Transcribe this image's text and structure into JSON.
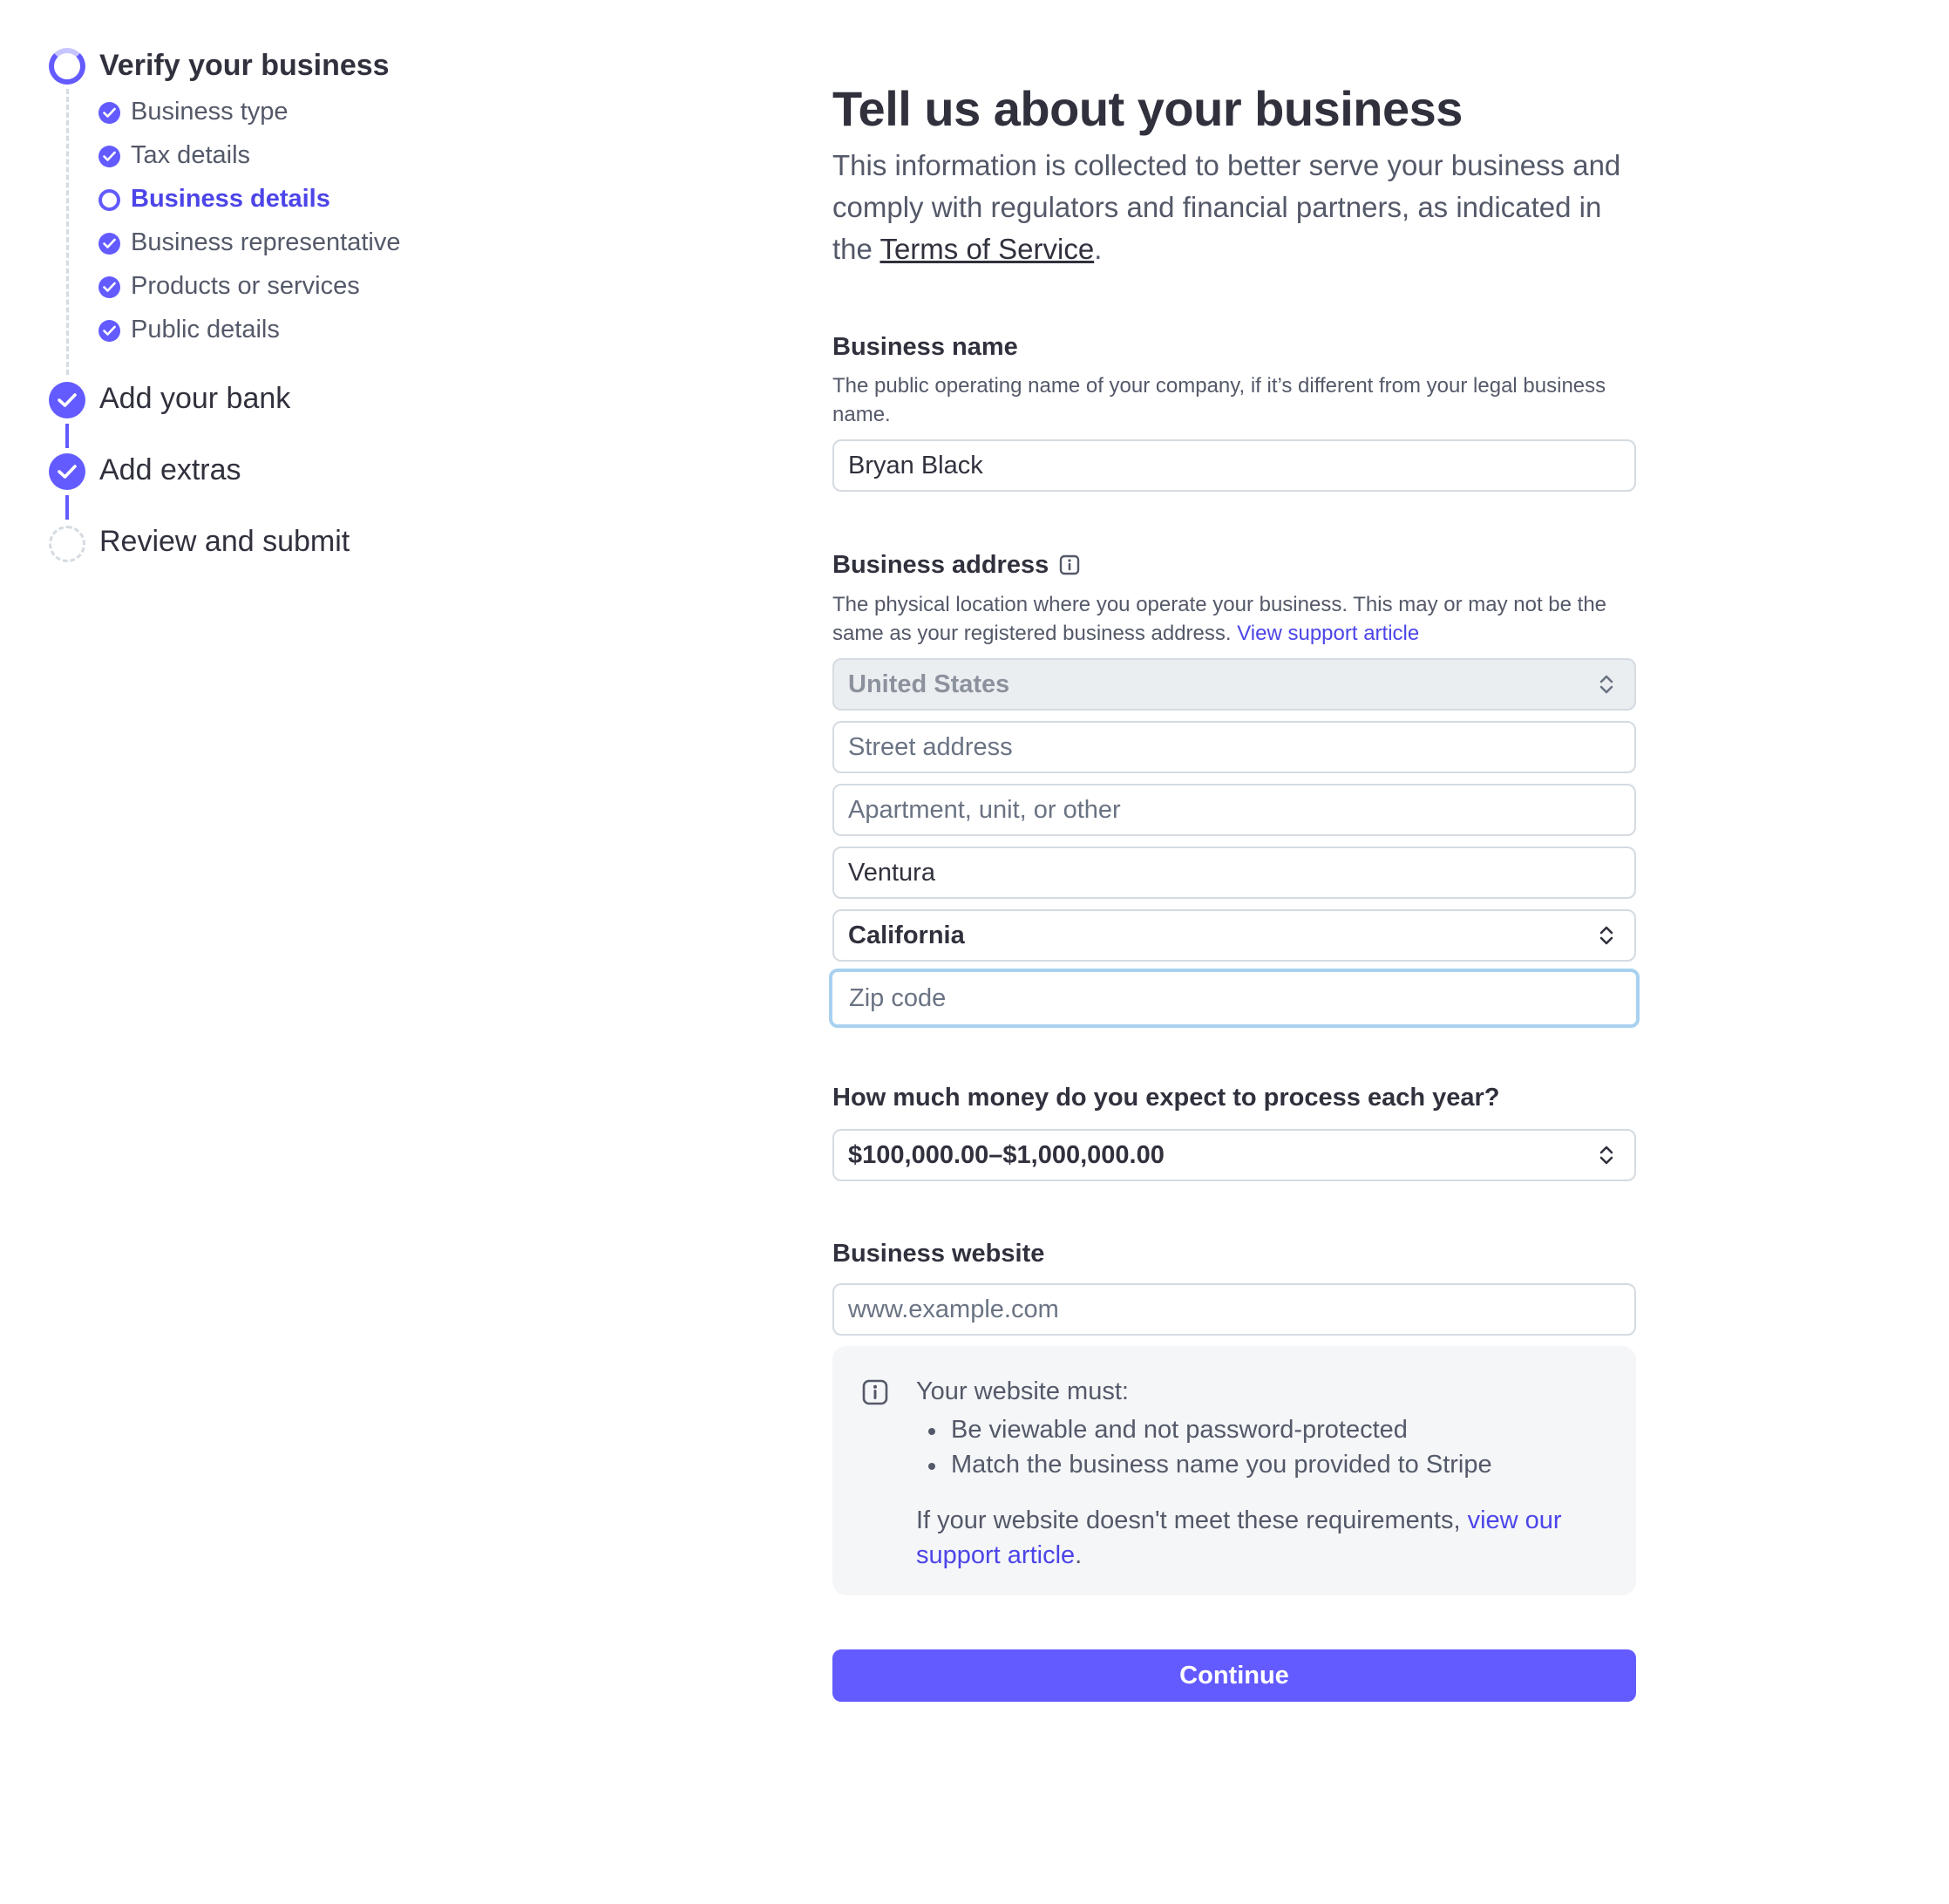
{
  "sidebar": {
    "steps": [
      {
        "label": "Verify your business",
        "status": "in-progress"
      },
      {
        "label": "Add your bank",
        "status": "complete"
      },
      {
        "label": "Add extras",
        "status": "complete"
      },
      {
        "label": "Review and submit",
        "status": "incomplete"
      }
    ],
    "substeps": [
      {
        "label": "Business type",
        "status": "complete"
      },
      {
        "label": "Tax details",
        "status": "complete"
      },
      {
        "label": "Business details",
        "status": "current"
      },
      {
        "label": "Business representative",
        "status": "complete"
      },
      {
        "label": "Products or services",
        "status": "complete"
      },
      {
        "label": "Public details",
        "status": "complete"
      }
    ]
  },
  "main": {
    "title": "Tell us about your business",
    "subtitle_before": "This information is collected to better serve your business and comply with regulators and financial partners, as indicated in the ",
    "subtitle_link": "Terms of Service",
    "subtitle_after": ".",
    "business_name": {
      "label": "Business name",
      "help": "The public operating name of your company, if it’s different from your legal business name.",
      "value": "Bryan Black"
    },
    "business_address": {
      "label": "Business address",
      "help": "The physical location where you operate your business. This may or may not be the same as your registered business address.",
      "help_link": "View support article",
      "country": "United States",
      "street_placeholder": "Street address",
      "apartment_placeholder": "Apartment, unit, or other",
      "city": "Ventura",
      "state": "California",
      "zip_placeholder": "Zip code"
    },
    "volume": {
      "label": "How much money do you expect to process each year?",
      "value": "$100,000.00–$1,000,000.00"
    },
    "website": {
      "label": "Business website",
      "placeholder": "www.example.com",
      "info_title": "Your website must:",
      "requirements": [
        "Be viewable and not password-protected",
        "Match the business name you provided to Stripe"
      ],
      "footer_before": "If your website doesn't meet these requirements, ",
      "footer_link": "view our support article",
      "footer_after": "."
    },
    "continue_label": "Continue"
  },
  "colors": {
    "accent": "#635bff",
    "link": "#4c45e8",
    "focus_ring": "#a8d1f0",
    "text_primary": "#30313d",
    "text_secondary": "#545969"
  },
  "icons": [
    "progress-ring-icon",
    "check-circle-icon",
    "empty-circle-icon",
    "dashed-circle-icon",
    "info-icon",
    "chevron-up-down-icon"
  ]
}
